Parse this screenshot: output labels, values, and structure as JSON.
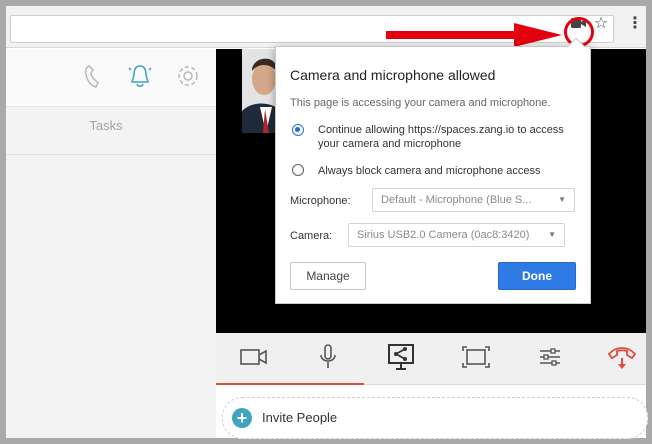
{
  "browser": {
    "icons": [
      "video-camera-icon",
      "star-icon",
      "kebab-menu-icon"
    ]
  },
  "sidebar": {
    "header_icons": [
      "phone-icon",
      "bell-icon",
      "gear-icon"
    ],
    "tasks_label": "Tasks"
  },
  "popup": {
    "title": "Camera and microphone allowed",
    "subtitle": "This page is accessing your camera and microphone.",
    "option_allow": "Continue allowing https://spaces.zang.io to access your camera and microphone",
    "option_block": "Always block camera and microphone access",
    "selected_option": "allow",
    "microphone_label": "Microphone:",
    "microphone_value": "Default - Microphone (Blue S...",
    "camera_label": "Camera:",
    "camera_value": "Sirius USB2.0 Camera (0ac8:3420)",
    "manage_label": "Manage",
    "done_label": "Done"
  },
  "controls": {
    "icons": [
      "video-camera-icon",
      "microphone-icon",
      "screen-share-icon",
      "fullscreen-icon",
      "settings-sliders-icon",
      "hang-up-icon"
    ]
  },
  "invite": {
    "label": "Invite People"
  },
  "colors": {
    "annotation_red": "#e4000f",
    "done_blue": "#2f7be6",
    "accent_teal": "#3fa4bd",
    "hangup_red": "#e24a3b"
  }
}
